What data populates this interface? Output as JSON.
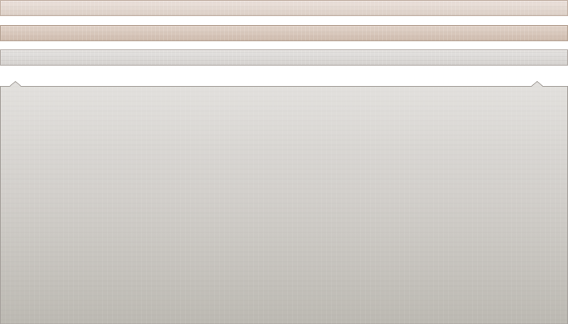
{
  "colors": {
    "page_background": "#ffffff",
    "bar_top": "#e6dbd4",
    "bar_middle": "#d9c9bd",
    "bar_bottom": "#dcdad8",
    "panel_top": "#e2e0dd",
    "panel_bottom": "#bdbab3",
    "panel_border": "#a8a39e"
  },
  "bars": [
    {
      "name": "top-bar"
    },
    {
      "name": "middle-bar"
    },
    {
      "name": "bottom-bar"
    }
  ],
  "panel": {
    "notch_left": "present",
    "notch_right": "present"
  }
}
